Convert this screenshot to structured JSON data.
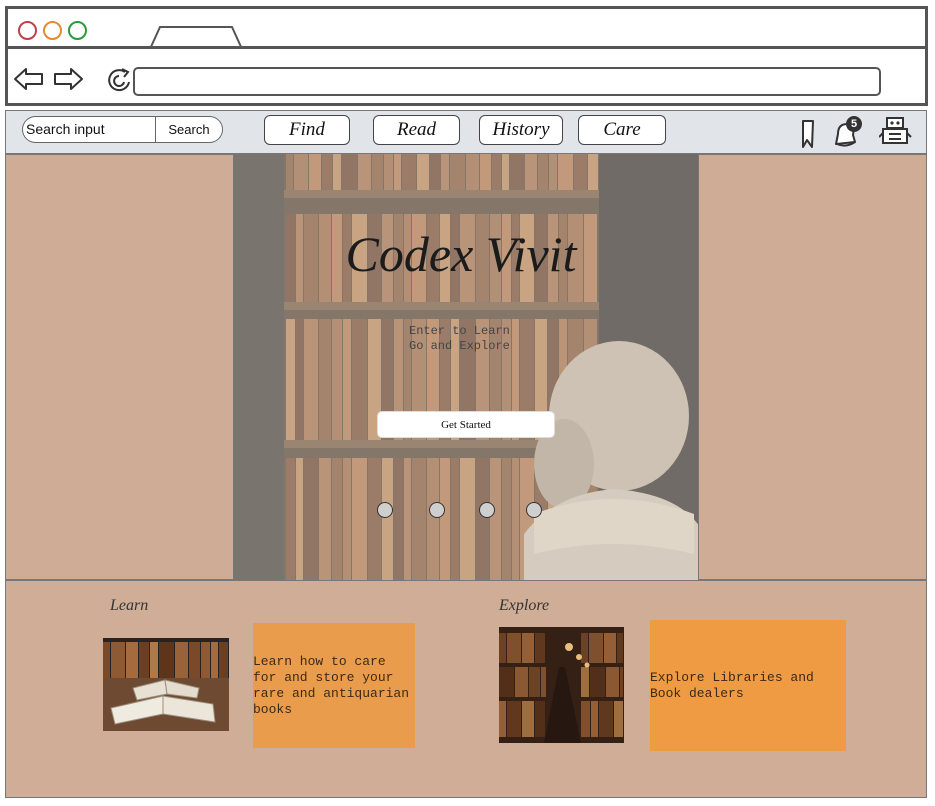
{
  "browser": {
    "window_controls": [
      "close",
      "minimize",
      "maximize"
    ],
    "colors": {
      "close": "#c0404a",
      "minimize": "#e38a2e",
      "maximize": "#2a9a3a"
    },
    "back_icon": "arrow-left-icon",
    "forward_icon": "arrow-right-icon",
    "reload_icon": "reload-icon",
    "address_value": ""
  },
  "nav": {
    "search_placeholder": "Search input",
    "search_button": "Search",
    "tabs": [
      {
        "label": "Find"
      },
      {
        "label": "Read"
      },
      {
        "label": "History"
      },
      {
        "label": "Care"
      }
    ],
    "notification_count": "5",
    "icons": [
      "bookmark-icon",
      "notification-icon",
      "robot-icon"
    ]
  },
  "hero": {
    "title": "Codex Vivit",
    "tagline_line1": "Enter to Learn",
    "tagline_line2": "Go and Explore",
    "cta": "Get Started",
    "carousel_slides": 4,
    "carousel_active": 0
  },
  "sections": {
    "learn": {
      "heading": "Learn",
      "text": "Learn how to care for and store your rare and antiquarian books"
    },
    "explore": {
      "heading": "Explore",
      "text": "Explore Libraries and Book dealers"
    }
  },
  "colors": {
    "side_panel": "#cfac95",
    "orange_box": "#e99c4c",
    "navbar": "#e1e4e9"
  }
}
